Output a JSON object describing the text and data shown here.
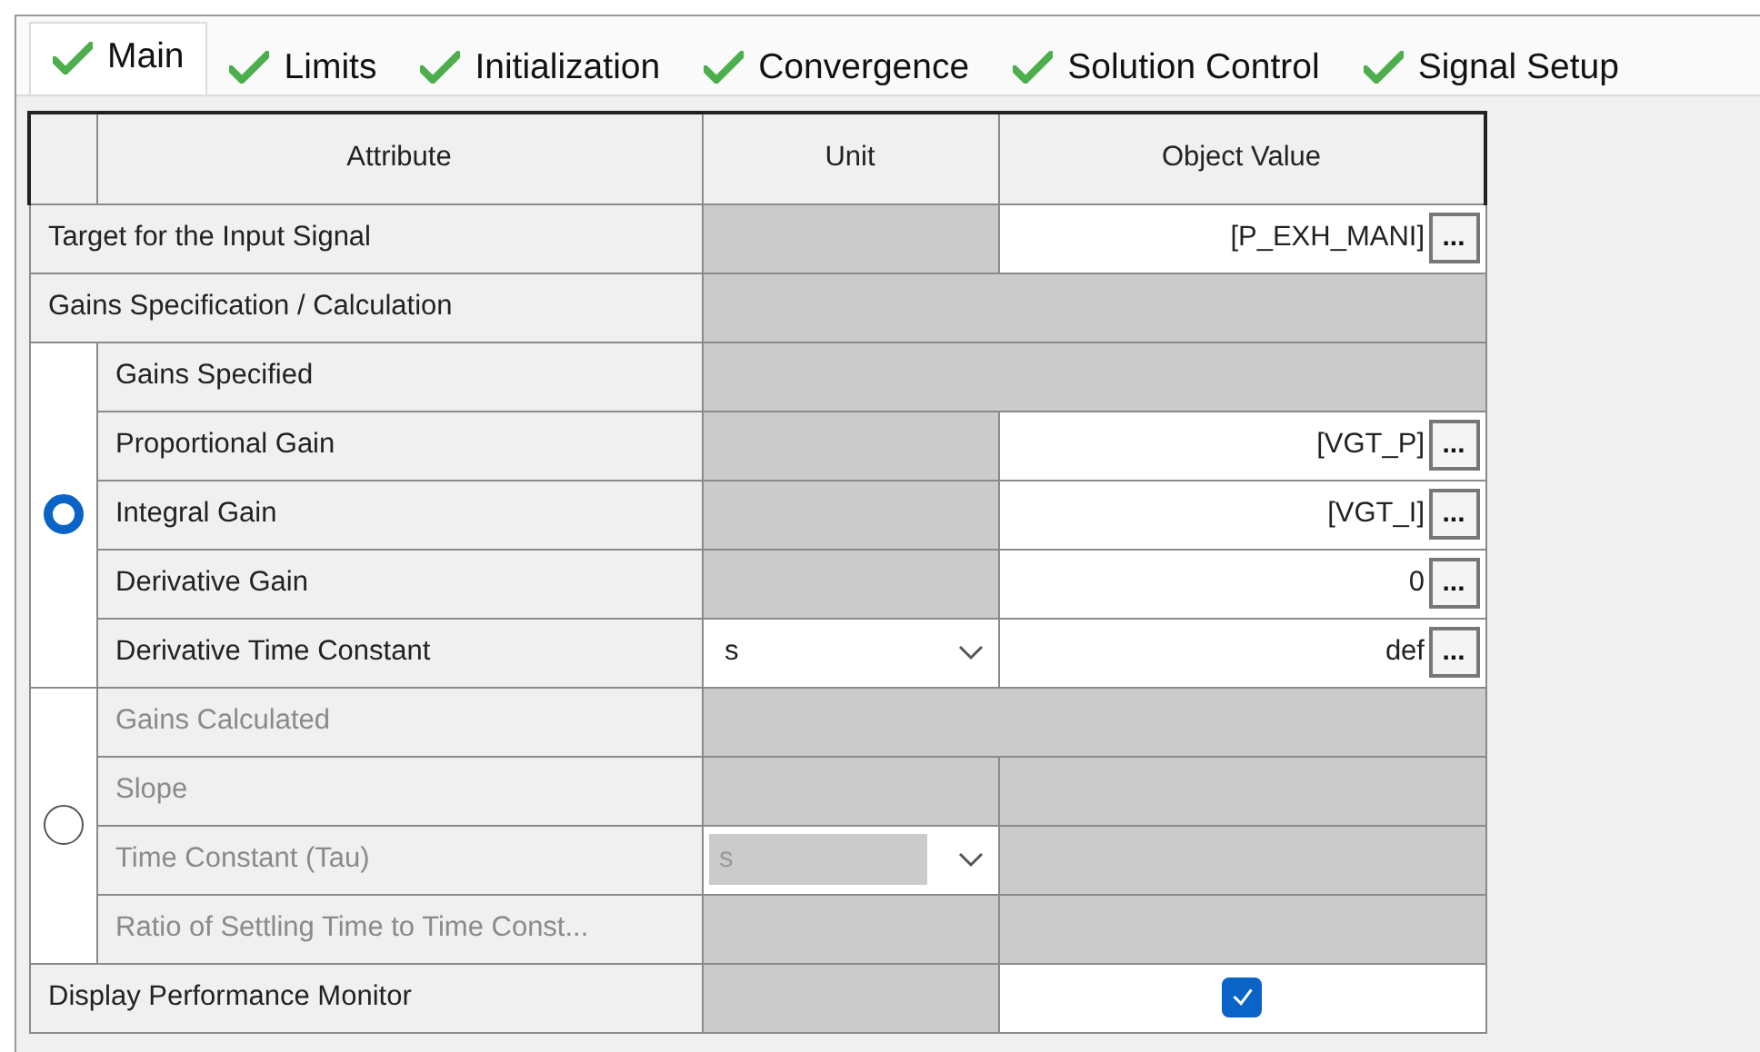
{
  "tabs": [
    {
      "label": "Main",
      "selected": true
    },
    {
      "label": "Limits",
      "selected": false
    },
    {
      "label": "Initialization",
      "selected": false
    },
    {
      "label": "Convergence",
      "selected": false
    },
    {
      "label": "Solution Control",
      "selected": false
    },
    {
      "label": "Signal Setup",
      "selected": false
    }
  ],
  "table": {
    "columns": [
      "Attribute",
      "Unit",
      "Object Value"
    ],
    "rows": [
      {
        "kind": "value",
        "label": "Target for the Input Signal",
        "disabled": false,
        "value": "[P_EXH_MANI]",
        "browse": "..."
      },
      {
        "kind": "heading",
        "label": "Gains Specification / Calculation",
        "disabled": false
      },
      {
        "kind": "group",
        "selected": true,
        "children": [
          {
            "kind": "heading",
            "label": "Gains Specified",
            "disabled": false
          },
          {
            "kind": "value",
            "label": "Proportional Gain",
            "disabled": false,
            "value": "[VGT_P]",
            "browse": "..."
          },
          {
            "kind": "value",
            "label": "Integral Gain",
            "disabled": false,
            "value": "[VGT_I]",
            "browse": "..."
          },
          {
            "kind": "value",
            "label": "Derivative Gain",
            "disabled": false,
            "value": "0",
            "browse": "..."
          },
          {
            "kind": "value",
            "label": "Derivative Time Constant",
            "disabled": false,
            "unit": "s",
            "value": "def",
            "browse": "..."
          }
        ]
      },
      {
        "kind": "group",
        "selected": false,
        "children": [
          {
            "kind": "heading",
            "label": "Gains Calculated",
            "disabled": true
          },
          {
            "kind": "value",
            "label": "Slope",
            "disabled": true
          },
          {
            "kind": "value",
            "label": "Time Constant (Tau)",
            "disabled": true,
            "unit": "s"
          },
          {
            "kind": "value",
            "label": "Ratio of Settling Time to Time Const...",
            "disabled": true
          }
        ]
      },
      {
        "kind": "checkbox",
        "label": "Display Performance Monitor",
        "disabled": false,
        "checked": true
      }
    ]
  }
}
